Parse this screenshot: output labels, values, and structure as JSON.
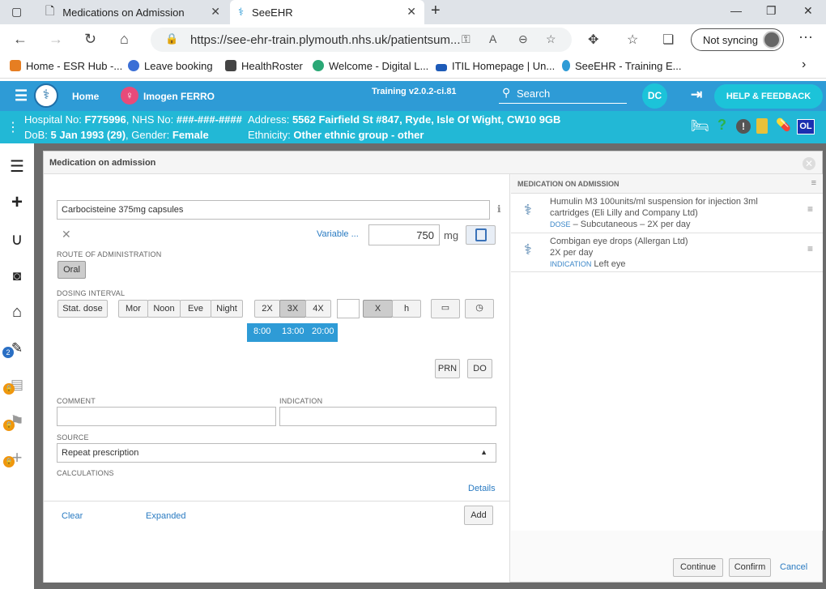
{
  "browser": {
    "tabs": [
      {
        "title": "Medications on Admission",
        "active": false
      },
      {
        "title": "SeeEHR",
        "active": true
      }
    ],
    "url": "https://see-ehr-train.plymouth.nhs.uk/patientsum...",
    "sync_label": "Not syncing",
    "bookmarks": [
      {
        "label": "Home - ESR Hub -...",
        "color": "#e67e22"
      },
      {
        "label": "Leave booking",
        "color": "#3b6fd6"
      },
      {
        "label": "HealthRoster",
        "color": "#444444"
      },
      {
        "label": "Welcome - Digital L...",
        "color": "#2aa876"
      },
      {
        "label": "ITIL Homepage | Un...",
        "color": "#1e5bb8"
      },
      {
        "label": "SeeEHR - Training E...",
        "color": "#2e9bd6"
      }
    ]
  },
  "app": {
    "home_label": "Home",
    "patient_name": "Imogen FERRO",
    "version": "Training v2.0.2-ci.81",
    "search_label": "Search",
    "user_initials": "DC",
    "help_label": "HELP & FEEDBACK",
    "ol_badge": "OL",
    "colors": {
      "header": "#2e9bd6",
      "patient_bar": "#22b8d6",
      "accent": "#1cc3d9"
    }
  },
  "patient": {
    "hospital_no_label": "Hospital No:",
    "hospital_no": "F775996",
    "nhs_label": ", NHS No:",
    "nhs_no": "###-###-####",
    "address_label": "Address:",
    "address": "5562 Fairfield St #847, Ryde, Isle Of Wight, CW10 9GB",
    "dob_label": "DoB:",
    "dob": "5 Jan 1993 (29)",
    "gender_label": ", Gender:",
    "gender": "Female",
    "ethnicity_label": "Ethnicity:",
    "ethnicity": "Other ethnic group - other"
  },
  "leftnav": {
    "badge_count": "2"
  },
  "dialog": {
    "title": "Medication on admission",
    "medication_input": "Carbocisteine 375mg capsules",
    "variable_link": "Variable ...",
    "dose_value": "750",
    "dose_unit": "mg",
    "route_label": "ROUTE OF ADMINISTRATION",
    "route_option": "Oral",
    "dosing_label": "DOSING INTERVAL",
    "stat_dose": "Stat. dose",
    "times_of_day": [
      "Mor",
      "Noon",
      "Eve",
      "Night"
    ],
    "frequencies": [
      "2X",
      "3X",
      "4X"
    ],
    "selected_frequency": "3X",
    "custom_x": "X",
    "custom_h": "h",
    "time_slots": [
      "8:00",
      "13:00",
      "20:00"
    ],
    "prn": "PRN",
    "do": "DO",
    "comment_label": "COMMENT",
    "indication_label": "INDICATION",
    "source_label": "SOURCE",
    "source_value": "Repeat prescription",
    "calculations_label": "CALCULATIONS",
    "details_link": "Details",
    "clear_link": "Clear",
    "expanded_link": "Expanded",
    "add_button": "Add",
    "continue_button": "Continue",
    "confirm_button": "Confirm",
    "cancel_link": "Cancel"
  },
  "med_list": {
    "title": "MEDICATION ON ADMISSION",
    "items": [
      {
        "name_line1": "Humulin M3 100units/ml suspension for injection 3ml",
        "name_line2": "cartridges (Eli Lilly and Company Ltd)",
        "detail_key": "DOSE",
        "detail_value": "– Subcutaneous – 2X per day"
      },
      {
        "name_line1": "Combigan eye drops (Allergan Ltd)",
        "name_line2": "2X per day",
        "detail_key": "INDICATION",
        "detail_value": "Left eye"
      }
    ]
  }
}
